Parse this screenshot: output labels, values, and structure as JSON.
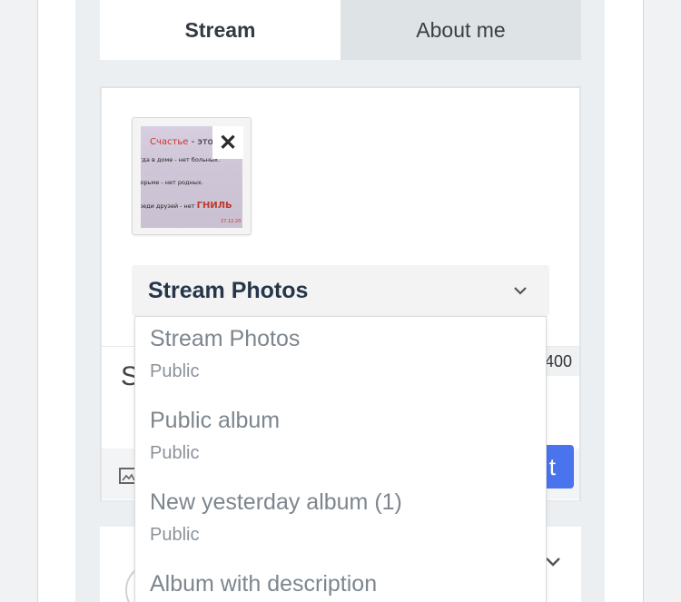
{
  "tabs": [
    {
      "label": "Stream",
      "active": true
    },
    {
      "label": "About me",
      "active": false
    }
  ],
  "attachment": {
    "thumbnail_text": [
      {
        "segments": [
          {
            "text": "Счастье",
            "color": "#d32f2f"
          },
          {
            "text": " - это",
            "color": "#222222"
          }
        ]
      },
      {
        "segments": [
          {
            "text": "гда в доме - нет больных.",
            "color": "#222222"
          }
        ]
      },
      {
        "segments": [
          {
            "text": "юрьме - нет родных.",
            "color": "#222222"
          }
        ]
      },
      {
        "segments": [
          {
            "text": "реди друзей - нет ",
            "color": "#222222"
          },
          {
            "text": "ГНИЛЬ",
            "color": "#c0392b"
          }
        ]
      }
    ],
    "thumbnail_date": "27.12.20",
    "remove_icon": "close-icon"
  },
  "composer": {
    "text_partial": "S",
    "char_counter": "400",
    "share_label_partial": "t",
    "image_icon": "image-icon"
  },
  "album_select": {
    "selected": "Stream Photos",
    "chevron_icon": "chevron-down-icon",
    "options": [
      {
        "title": "Stream Photos",
        "privacy": "Public"
      },
      {
        "title": "Public album",
        "privacy": "Public"
      },
      {
        "title": "New yesterday album (1)",
        "privacy": "Public"
      },
      {
        "title": "Album with description",
        "privacy": ""
      }
    ]
  },
  "colors": {
    "accent": "#4a73ee",
    "tab_inactive_bg": "#dee3e6",
    "page_bg": "#eceff1"
  }
}
